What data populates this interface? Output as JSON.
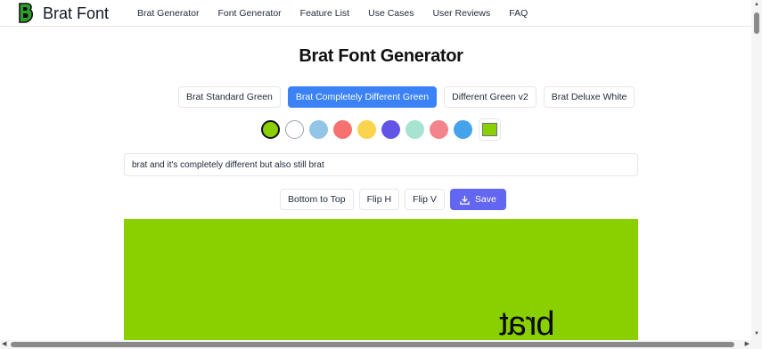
{
  "header": {
    "brand": "Brat Font",
    "logo_icon": "letter-b-logo-icon",
    "nav": [
      "Brat Generator",
      "Font Generator",
      "Feature List",
      "Use Cases",
      "User Reviews",
      "FAQ"
    ]
  },
  "main": {
    "title": "Brat Font Generator",
    "style_tabs": [
      {
        "label": "Brat Standard Green",
        "active": false
      },
      {
        "label": "Brat Completely Different Green",
        "active": true
      },
      {
        "label": "Different Green v2",
        "active": false
      },
      {
        "label": "Brat Deluxe White",
        "active": false
      }
    ],
    "swatches": [
      "#8acf00",
      "#ffffff",
      "#93c5e8",
      "#f87171",
      "#fcd34d",
      "#6354e8",
      "#a7e3d0",
      "#f4848c",
      "#44a3ea"
    ],
    "selected_swatch": "#8acf00",
    "custom_color": "#8acf00",
    "text_input": {
      "value": "brat and it's completely different but also still brat",
      "placeholder": ""
    },
    "actions": {
      "bottom_to_top": "Bottom to Top",
      "flip_h": "Flip H",
      "flip_v": "Flip V",
      "save": "Save",
      "save_icon": "download-icon"
    },
    "canvas": {
      "background": "#8acf00",
      "visible_text": "brat"
    }
  },
  "colors": {
    "accent_blue": "#3b82f6",
    "save_purple": "#6366f1"
  }
}
